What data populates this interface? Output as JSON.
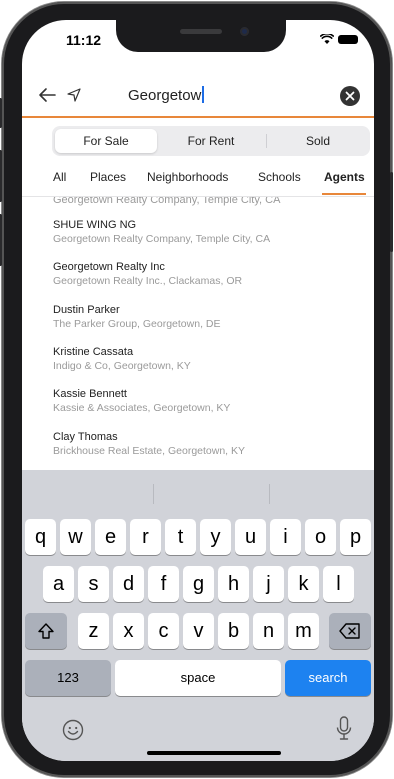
{
  "status_bar": {
    "time": "11:12"
  },
  "search": {
    "query": "Georgetow"
  },
  "segments": [
    {
      "label": "For Sale",
      "active": true
    },
    {
      "label": "For Rent",
      "active": false
    },
    {
      "label": "Sold",
      "active": false
    }
  ],
  "tabs": [
    {
      "label": "All",
      "active": false
    },
    {
      "label": "Places",
      "active": false
    },
    {
      "label": "Neighborhoods",
      "active": false
    },
    {
      "label": "Schools",
      "active": false
    },
    {
      "label": "Agents",
      "active": true
    }
  ],
  "accent_color": "#e8873a",
  "results": {
    "partial_top": "Georgetown Realty Company, Temple City, CA",
    "items": [
      {
        "name": "SHUE WING NG",
        "detail": "Georgetown Realty Company, Temple City, CA"
      },
      {
        "name": "Georgetown Realty Inc",
        "detail": "Georgetown Realty Inc., Clackamas, OR"
      },
      {
        "name": "Dustin Parker",
        "detail": "The Parker Group, Georgetown, DE"
      },
      {
        "name": "Kristine Cassata",
        "detail": "Indigo & Co, Georgetown, KY"
      },
      {
        "name": "Kassie Bennett",
        "detail": "Kassie & Associates, Georgetown, KY"
      },
      {
        "name": "Clay Thomas",
        "detail": "Brickhouse Real Estate, Georgetown, KY"
      }
    ]
  },
  "keyboard": {
    "row1": [
      "q",
      "w",
      "e",
      "r",
      "t",
      "y",
      "u",
      "i",
      "o",
      "p"
    ],
    "row2": [
      "a",
      "s",
      "d",
      "f",
      "g",
      "h",
      "j",
      "k",
      "l"
    ],
    "row3": [
      "z",
      "x",
      "c",
      "v",
      "b",
      "n",
      "m"
    ],
    "numbers_label": "123",
    "space_label": "space",
    "search_label": "search",
    "search_color": "#1d82f0"
  }
}
